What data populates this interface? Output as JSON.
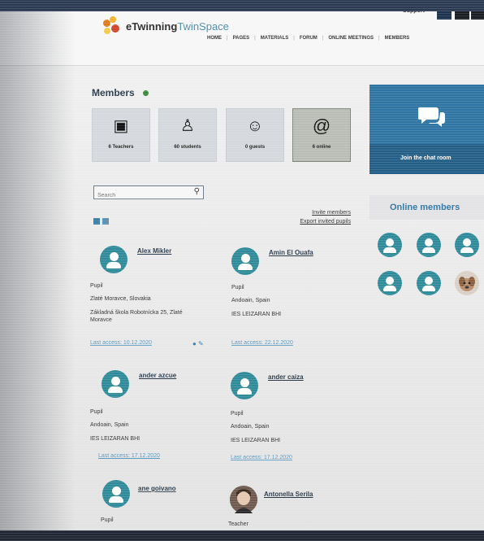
{
  "app": {
    "logo_text_main": "eTwinning",
    "logo_text_sub": "TwinSpace",
    "support_label": "Support"
  },
  "nav": {
    "items": [
      "HOME",
      "PAGES",
      "MATERIALS",
      "FORUM",
      "ONLINE MEETINGS",
      "MEMBERS"
    ]
  },
  "members": {
    "title": "Members",
    "stats": [
      {
        "label": "6 Teachers",
        "icon": "teacher-icon"
      },
      {
        "label": "60 students",
        "icon": "student-icon"
      },
      {
        "label": "0 guests",
        "icon": "guest-icon"
      },
      {
        "label": "6 online",
        "icon": "at-icon"
      }
    ],
    "search_placeholder": "Search",
    "invite_label": "Invite members",
    "export_label": "Export invited pupils"
  },
  "chat": {
    "join_label": "Join the chat room"
  },
  "online": {
    "title": "Online members",
    "count": 6
  },
  "cards": [
    {
      "name": "Alex Mikler",
      "role": "Pupil",
      "location": "Zlaté Moravce, Slovakia",
      "school": "Základná škola Robotnícka 25, Zlaté Moravce",
      "access": "Last access: 10.12.2020"
    },
    {
      "name": "Amin El Ouafa",
      "role": "Pupil",
      "location": "Andoain, Spain",
      "school": "IES LEIZARAN BHI",
      "access": "Last access: 22.12.2020"
    },
    {
      "name": "ander azcue",
      "role": "Pupil",
      "location": "Andoain, Spain",
      "school": "IES LEIZARAN BHI",
      "access": "Last access: 17.12.2020"
    },
    {
      "name": "ander caiza",
      "role": "Pupil",
      "location": "Andoain, Spain",
      "school": "IES LEIZARAN BHI",
      "access": "Last access: 17.12.2020"
    },
    {
      "name": "ane goivano",
      "role": "Pupil",
      "location": "",
      "school": "",
      "access": ""
    },
    {
      "name": "Antonella Serila",
      "role": "Teacher",
      "location": "",
      "school": "",
      "access": ""
    }
  ],
  "colors": {
    "accent": "#2f75a3",
    "avatar": "#2f8a9a",
    "title": "#2a3a4a"
  }
}
